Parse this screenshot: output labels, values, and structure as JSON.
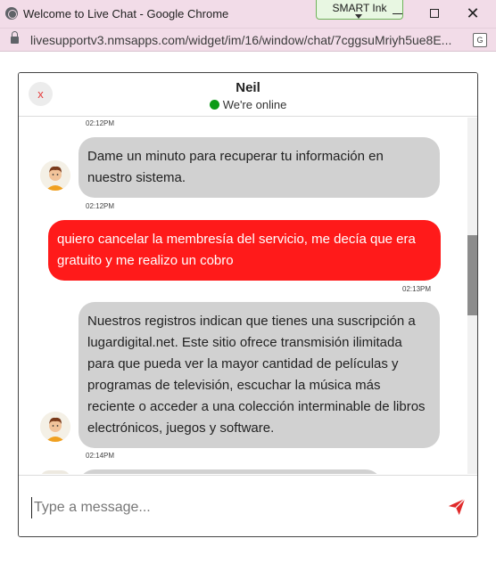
{
  "browser": {
    "window_title": "Welcome to Live Chat - Google Chrome",
    "extension_label": "SMART Ink",
    "url": "livesupportv3.nmsapps.com/widget/im/16/window/chat/7cggsuMriyh5ue8E..."
  },
  "chat": {
    "close_label": "x",
    "agent_name": "Neil",
    "status": "We're online",
    "status_color": "#0a9a16",
    "messages": [
      {
        "sender": "agent",
        "time": "02:12PM",
        "text": ""
      },
      {
        "sender": "agent",
        "time": "02:12PM",
        "text": "Dame un minuto para recuperar tu información en nuestro sistema."
      },
      {
        "sender": "user",
        "time": "02:13PM",
        "text": "quiero cancelar la membresía del servicio, me decía que era gratuito y me realizo un cobro"
      },
      {
        "sender": "agent",
        "time": "02:14PM",
        "text": "Nuestros registros indican que tienes una suscripción a lugardigital.net. Este sitio ofrece transmisión ilimitada para que pueda ver la mayor cantidad de películas y programas de televisión, escuchar la música más reciente o acceder a una colección interminable de libros electrónicos, juegos y software."
      }
    ],
    "input": {
      "placeholder": "Type a message...",
      "value": ""
    },
    "colors": {
      "user_bubble": "#ff1a1a",
      "agent_bubble": "#d1d1d1",
      "send_icon": "#e02a2a"
    }
  }
}
